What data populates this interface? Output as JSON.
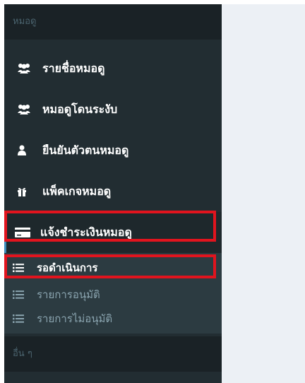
{
  "sidebar": {
    "section_doctors": "หมอดู",
    "items": [
      {
        "label": "รายชื่อหมอดู",
        "icon": "users-icon"
      },
      {
        "label": "หมอดูโดนระงับ",
        "icon": "users-icon"
      },
      {
        "label": "ยืนยันตัวตนหมอดู",
        "icon": "user-icon"
      },
      {
        "label": "แพ็คเกจหมอดู",
        "icon": "gift-icon"
      },
      {
        "label": "แจ้งชำระเงินหมอดู",
        "icon": "credit-card-icon"
      }
    ],
    "submenu": [
      {
        "label": "รอดำเนินการ",
        "icon": "list-icon"
      },
      {
        "label": "รายการอนุมัติ",
        "icon": "list-icon"
      },
      {
        "label": "รายการไม่อนุมัติ",
        "icon": "list-icon"
      }
    ],
    "section_other": "อื่น ๆ"
  },
  "colors": {
    "sidebar_bg": "#222d32",
    "submenu_bg": "#2c3b41",
    "highlight": "#e1141e",
    "content_bg": "#ecf0f5"
  }
}
